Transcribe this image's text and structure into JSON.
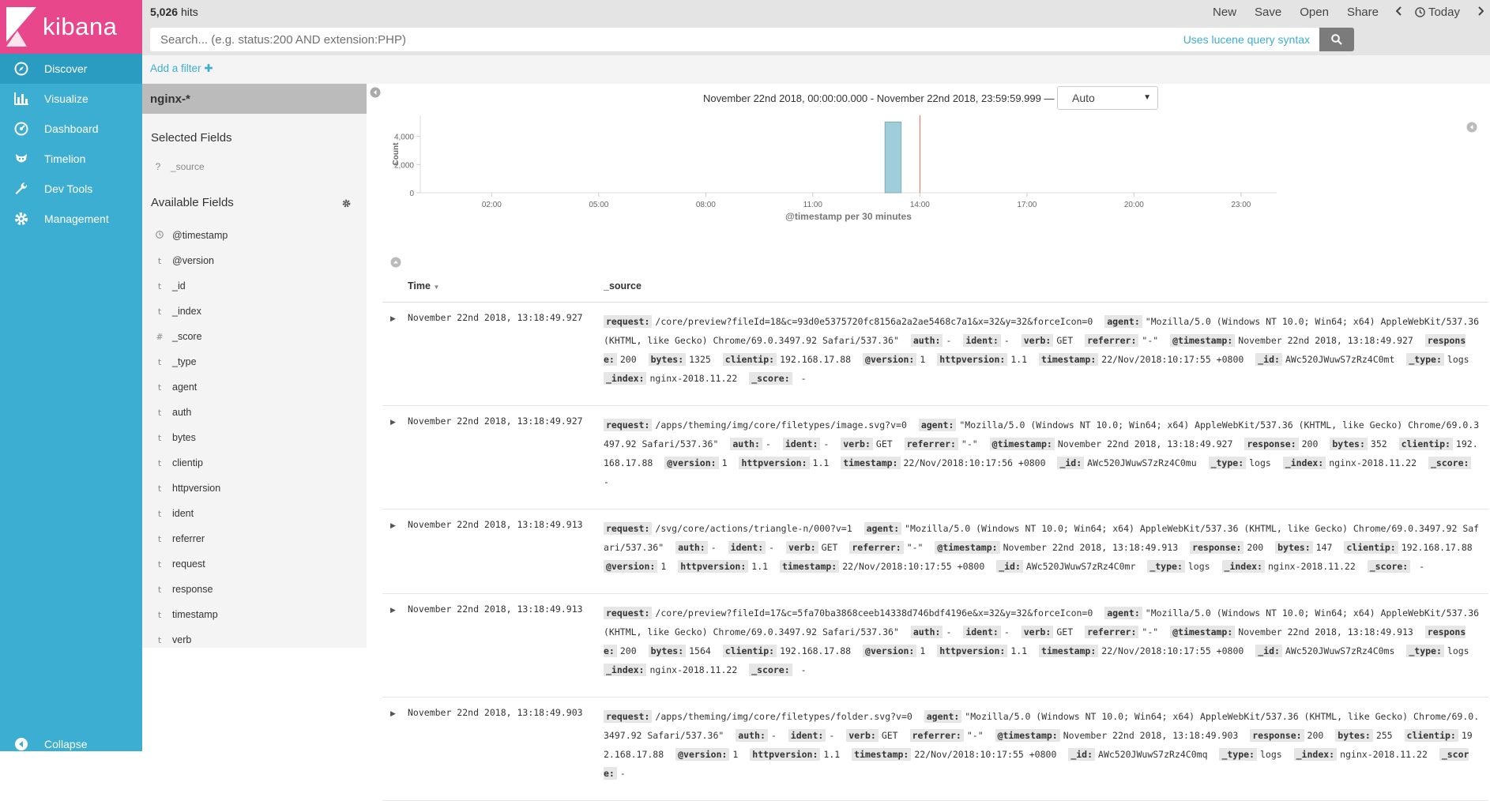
{
  "app": {
    "name": "kibana"
  },
  "nav": {
    "items": [
      {
        "label": "Discover",
        "icon": "compass-icon"
      },
      {
        "label": "Visualize",
        "icon": "bar-chart-icon"
      },
      {
        "label": "Dashboard",
        "icon": "dashboard-icon"
      },
      {
        "label": "Timelion",
        "icon": "timelion-icon"
      },
      {
        "label": "Dev Tools",
        "icon": "wrench-icon"
      },
      {
        "label": "Management",
        "icon": "gear-icon"
      }
    ],
    "collapse_label": "Collapse"
  },
  "topbar": {
    "hits_count": "5,026",
    "hits_label": "hits",
    "menu": {
      "new": "New",
      "save": "Save",
      "open": "Open",
      "share": "Share",
      "today": "Today"
    }
  },
  "search": {
    "placeholder": "Search... (e.g. status:200 AND extension:PHP)",
    "value": "",
    "lucene_link": "Uses lucene query syntax"
  },
  "filter": {
    "add_label": "Add a filter"
  },
  "sidebar": {
    "index_pattern": "nginx-*",
    "selected_title": "Selected Fields",
    "selected_fields": [
      {
        "type": "?",
        "name": "_source"
      }
    ],
    "available_title": "Available Fields",
    "available_fields": [
      {
        "type": "clock",
        "name": "@timestamp"
      },
      {
        "type": "t",
        "name": "@version"
      },
      {
        "type": "t",
        "name": "_id"
      },
      {
        "type": "t",
        "name": "_index"
      },
      {
        "type": "#",
        "name": "_score"
      },
      {
        "type": "t",
        "name": "_type"
      },
      {
        "type": "t",
        "name": "agent"
      },
      {
        "type": "t",
        "name": "auth"
      },
      {
        "type": "t",
        "name": "bytes"
      },
      {
        "type": "t",
        "name": "clientip"
      },
      {
        "type": "t",
        "name": "httpversion"
      },
      {
        "type": "t",
        "name": "ident"
      },
      {
        "type": "t",
        "name": "referrer"
      },
      {
        "type": "t",
        "name": "request"
      },
      {
        "type": "t",
        "name": "response"
      },
      {
        "type": "t",
        "name": "timestamp"
      },
      {
        "type": "t",
        "name": "verb"
      }
    ]
  },
  "main": {
    "time_range": "November 22nd 2018, 00:00:00.000 - November 22nd 2018, 23:59:59.999 —",
    "interval": "Auto",
    "table": {
      "col_time": "Time",
      "col_source": "_source"
    }
  },
  "chart_data": {
    "type": "bar",
    "title": "",
    "xlabel": "@timestamp per 30 minutes",
    "ylabel": "Count",
    "x_range_hours": [
      0,
      24
    ],
    "ylim": [
      0,
      5500
    ],
    "yticks": [
      0,
      2000,
      4000
    ],
    "ytick_labels": [
      "0",
      "2,000",
      "4,000"
    ],
    "xticks_hours": [
      2,
      5,
      8,
      11,
      14,
      17,
      20,
      23
    ],
    "xtick_labels": [
      "02:00",
      "05:00",
      "08:00",
      "11:00",
      "14:00",
      "17:00",
      "20:00",
      "23:00"
    ],
    "bars": [
      {
        "start_hour": 13.0,
        "end_hour": 13.5,
        "value": 5026
      }
    ],
    "now_marker_hour": 14.0,
    "bar_color": "#9fcdd8",
    "marker_color": "#e7664c",
    "grid": false
  },
  "documents": [
    {
      "time": "November 22nd 2018, 13:18:49.927",
      "fields": [
        {
          "k": "request:",
          "v": "/core/preview?fileId=18&c=93d0e5375720fc8156a2a2ae5468c7a1&x=32&y=32&forceIcon=0"
        },
        {
          "k": "agent:",
          "v": "\"Mozilla/5.0 (Windows NT 10.0; Win64; x64) AppleWebKit/537.36 (KHTML, like Gecko) Chrome/69.0.3497.92 Safari/537.36\""
        },
        {
          "k": "auth:",
          "v": "-"
        },
        {
          "k": "ident:",
          "v": "-"
        },
        {
          "k": "verb:",
          "v": "GET"
        },
        {
          "k": "referrer:",
          "v": "\"-\""
        },
        {
          "k": "@timestamp:",
          "v": "November 22nd 2018, 13:18:49.927"
        },
        {
          "k": "response:",
          "v": "200"
        },
        {
          "k": "bytes:",
          "v": "1325"
        },
        {
          "k": "clientip:",
          "v": "192.168.17.88"
        },
        {
          "k": "@version:",
          "v": "1"
        },
        {
          "k": "httpversion:",
          "v": "1.1"
        },
        {
          "k": "timestamp:",
          "v": "22/Nov/2018:10:17:55 +0800"
        },
        {
          "k": "_id:",
          "v": "AWc520JWuwS7zRz4C0mt"
        },
        {
          "k": "_type:",
          "v": "logs"
        },
        {
          "k": "_index:",
          "v": "nginx-2018.11.22"
        },
        {
          "k": "_score:",
          "v": " -"
        }
      ]
    },
    {
      "time": "November 22nd 2018, 13:18:49.927",
      "fields": [
        {
          "k": "request:",
          "v": "/apps/theming/img/core/filetypes/image.svg?v=0"
        },
        {
          "k": "agent:",
          "v": "\"Mozilla/5.0 (Windows NT 10.0; Win64; x64) AppleWebKit/537.36 (KHTML, like Gecko) Chrome/69.0.3497.92 Safari/537.36\""
        },
        {
          "k": "auth:",
          "v": "-"
        },
        {
          "k": "ident:",
          "v": "-"
        },
        {
          "k": "verb:",
          "v": "GET"
        },
        {
          "k": "referrer:",
          "v": "\"-\""
        },
        {
          "k": "@timestamp:",
          "v": "November 22nd 2018, 13:18:49.927"
        },
        {
          "k": "response:",
          "v": "200"
        },
        {
          "k": "bytes:",
          "v": "352"
        },
        {
          "k": "clientip:",
          "v": "192.168.17.88"
        },
        {
          "k": "@version:",
          "v": "1"
        },
        {
          "k": "httpversion:",
          "v": "1.1"
        },
        {
          "k": "timestamp:",
          "v": "22/Nov/2018:10:17:56 +0800"
        },
        {
          "k": "_id:",
          "v": "AWc520JWuwS7zRz4C0mu"
        },
        {
          "k": "_type:",
          "v": "logs"
        },
        {
          "k": "_index:",
          "v": "nginx-2018.11.22"
        },
        {
          "k": "_score:",
          "v": "-"
        }
      ]
    },
    {
      "time": "November 22nd 2018, 13:18:49.913",
      "fields": [
        {
          "k": "request:",
          "v": "/svg/core/actions/triangle-n/000?v=1"
        },
        {
          "k": "agent:",
          "v": "\"Mozilla/5.0 (Windows NT 10.0; Win64; x64) AppleWebKit/537.36 (KHTML, like Gecko) Chrome/69.0.3497.92 Safari/537.36\""
        },
        {
          "k": "auth:",
          "v": "-"
        },
        {
          "k": "ident:",
          "v": "-"
        },
        {
          "k": "verb:",
          "v": "GET"
        },
        {
          "k": "referrer:",
          "v": "\"-\""
        },
        {
          "k": "@timestamp:",
          "v": "November 22nd 2018, 13:18:49.913"
        },
        {
          "k": "response:",
          "v": "200"
        },
        {
          "k": "bytes:",
          "v": "147"
        },
        {
          "k": "clientip:",
          "v": "192.168.17.88"
        },
        {
          "k": "@version:",
          "v": "1"
        },
        {
          "k": "httpversion:",
          "v": "1.1"
        },
        {
          "k": "timestamp:",
          "v": "22/Nov/2018:10:17:55 +0800"
        },
        {
          "k": "_id:",
          "v": "AWc520JWuwS7zRz4C0mr"
        },
        {
          "k": "_type:",
          "v": "logs"
        },
        {
          "k": "_index:",
          "v": "nginx-2018.11.22"
        },
        {
          "k": "_score:",
          "v": " -"
        }
      ]
    },
    {
      "time": "November 22nd 2018, 13:18:49.913",
      "fields": [
        {
          "k": "request:",
          "v": "/core/preview?fileId=17&c=5fa70ba3868ceeb14338d746bdf4196e&x=32&y=32&forceIcon=0"
        },
        {
          "k": "agent:",
          "v": "\"Mozilla/5.0 (Windows NT 10.0; Win64; x64) AppleWebKit/537.36 (KHTML, like Gecko) Chrome/69.0.3497.92 Safari/537.36\""
        },
        {
          "k": "auth:",
          "v": "-"
        },
        {
          "k": "ident:",
          "v": "-"
        },
        {
          "k": "verb:",
          "v": "GET"
        },
        {
          "k": "referrer:",
          "v": "\"-\""
        },
        {
          "k": "@timestamp:",
          "v": "November 22nd 2018, 13:18:49.913"
        },
        {
          "k": "response:",
          "v": "200"
        },
        {
          "k": "bytes:",
          "v": "1564"
        },
        {
          "k": "clientip:",
          "v": "192.168.17.88"
        },
        {
          "k": "@version:",
          "v": "1"
        },
        {
          "k": "httpversion:",
          "v": "1.1"
        },
        {
          "k": "timestamp:",
          "v": "22/Nov/2018:10:17:55 +0800"
        },
        {
          "k": "_id:",
          "v": "AWc520JWuwS7zRz4C0ms"
        },
        {
          "k": "_type:",
          "v": "logs"
        },
        {
          "k": "_index:",
          "v": "nginx-2018.11.22"
        },
        {
          "k": "_score:",
          "v": " -"
        }
      ]
    },
    {
      "time": "November 22nd 2018, 13:18:49.903",
      "fields": [
        {
          "k": "request:",
          "v": "/apps/theming/img/core/filetypes/folder.svg?v=0"
        },
        {
          "k": "agent:",
          "v": "\"Mozilla/5.0 (Windows NT 10.0; Win64; x64) AppleWebKit/537.36 (KHTML, like Gecko) Chrome/69.0.3497.92 Safari/537.36\""
        },
        {
          "k": "auth:",
          "v": "-"
        },
        {
          "k": "ident:",
          "v": "-"
        },
        {
          "k": "verb:",
          "v": "GET"
        },
        {
          "k": "referrer:",
          "v": "\"-\""
        },
        {
          "k": "@timestamp:",
          "v": "November 22nd 2018, 13:18:49.903"
        },
        {
          "k": "response:",
          "v": "200"
        },
        {
          "k": "bytes:",
          "v": "255"
        },
        {
          "k": "clientip:",
          "v": "192.168.17.88"
        },
        {
          "k": "@version:",
          "v": "1"
        },
        {
          "k": "httpversion:",
          "v": "1.1"
        },
        {
          "k": "timestamp:",
          "v": "22/Nov/2018:10:17:55 +0800"
        },
        {
          "k": "_id:",
          "v": "AWc520JWuwS7zRz4C0mq"
        },
        {
          "k": "_type:",
          "v": "logs"
        },
        {
          "k": "_index:",
          "v": "nginx-2018.11.22"
        },
        {
          "k": "_score:",
          "v": "-"
        }
      ]
    }
  ]
}
